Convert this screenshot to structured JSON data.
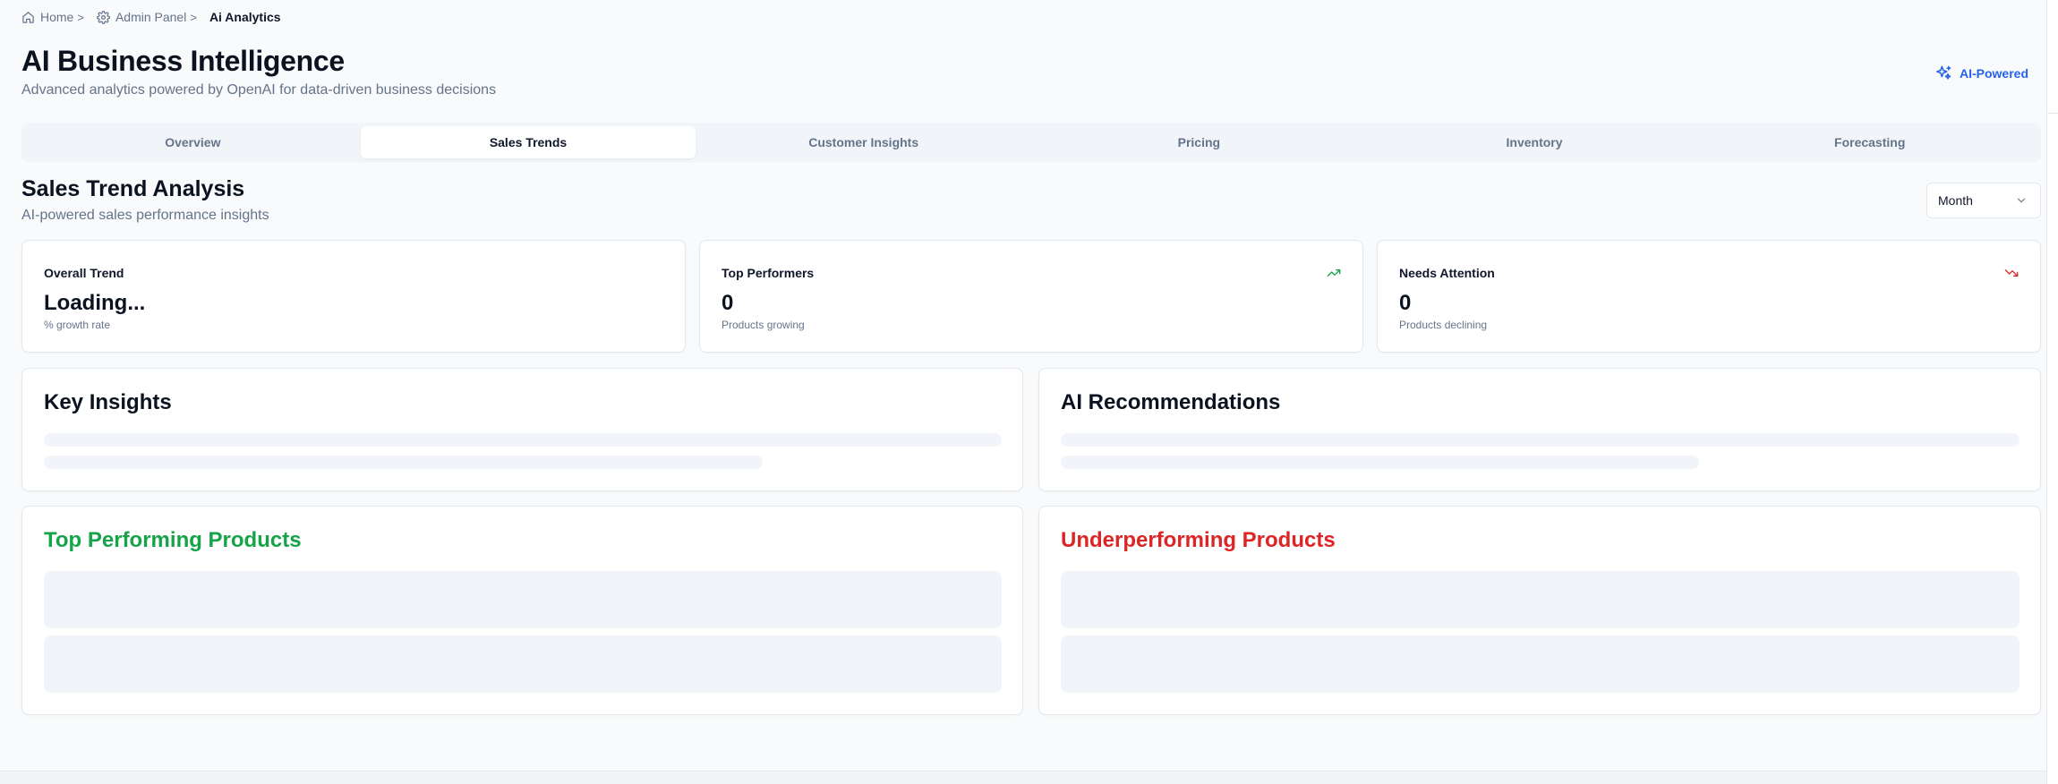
{
  "breadcrumb": {
    "home": "Home",
    "admin": "Admin Panel",
    "current": "Ai Analytics",
    "separator": ">"
  },
  "header": {
    "title": "AI Business Intelligence",
    "subtitle": "Advanced analytics powered by OpenAI for data-driven business decisions",
    "badge": "AI-Powered"
  },
  "tabs": [
    {
      "label": "Overview",
      "active": false
    },
    {
      "label": "Sales Trends",
      "active": true
    },
    {
      "label": "Customer Insights",
      "active": false
    },
    {
      "label": "Pricing",
      "active": false
    },
    {
      "label": "Inventory",
      "active": false
    },
    {
      "label": "Forecasting",
      "active": false
    }
  ],
  "section": {
    "title": "Sales Trend Analysis",
    "subtitle": "AI-powered sales performance insights",
    "period": "Month"
  },
  "stats": [
    {
      "title": "Overall Trend",
      "value": "Loading...",
      "note": "% growth rate",
      "icon": "none"
    },
    {
      "title": "Top Performers",
      "value": "0",
      "note": "Products growing",
      "icon": "trending-up-icon"
    },
    {
      "title": "Needs Attention",
      "value": "0",
      "note": "Products declining",
      "icon": "trending-down-icon"
    }
  ],
  "panels": {
    "key_insights": "Key Insights",
    "ai_recommendations": "AI Recommendations",
    "top_products": "Top Performing Products",
    "under_products": "Underperforming Products"
  },
  "colors": {
    "accent": "#2563eb",
    "positive": "#16a34a",
    "negative": "#dc2626",
    "muted": "#64748b",
    "skeleton": "#f1f5f9"
  }
}
